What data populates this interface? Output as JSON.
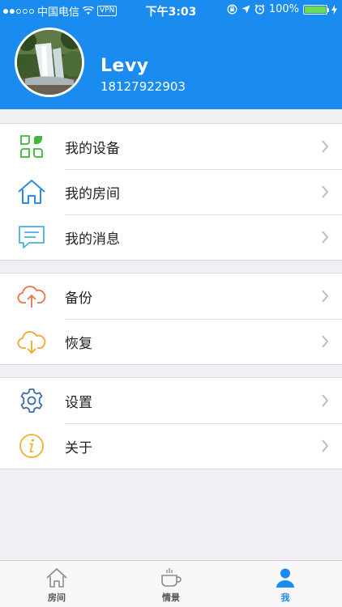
{
  "status_bar": {
    "carrier": "中国电信",
    "vpn": "VPN",
    "time": "下午3:03",
    "battery": "100%",
    "battery_level": 1.0
  },
  "profile": {
    "name": "Levy",
    "phone": "18127922903"
  },
  "groups": [
    {
      "items": [
        {
          "label": "我的设备",
          "icon": "devices-icon"
        },
        {
          "label": "我的房间",
          "icon": "house-icon"
        },
        {
          "label": "我的消息",
          "icon": "message-icon"
        }
      ]
    },
    {
      "items": [
        {
          "label": "备份",
          "icon": "cloud-upload-icon"
        },
        {
          "label": "恢复",
          "icon": "cloud-download-icon"
        }
      ]
    },
    {
      "items": [
        {
          "label": "设置",
          "icon": "gear-icon"
        },
        {
          "label": "关于",
          "icon": "info-icon"
        }
      ]
    }
  ],
  "tabbar": {
    "tabs": [
      {
        "label": "房间",
        "icon": "house-icon",
        "active": false
      },
      {
        "label": "情景",
        "icon": "cup-icon",
        "active": false
      },
      {
        "label": "我",
        "icon": "person-icon",
        "active": true
      }
    ]
  },
  "colors": {
    "accent": "#1a8cf0",
    "devices": "#3db83d",
    "upload": "#e8734a",
    "download": "#f0a830",
    "info": "#f0b030",
    "gear": "#3a6ea8"
  }
}
